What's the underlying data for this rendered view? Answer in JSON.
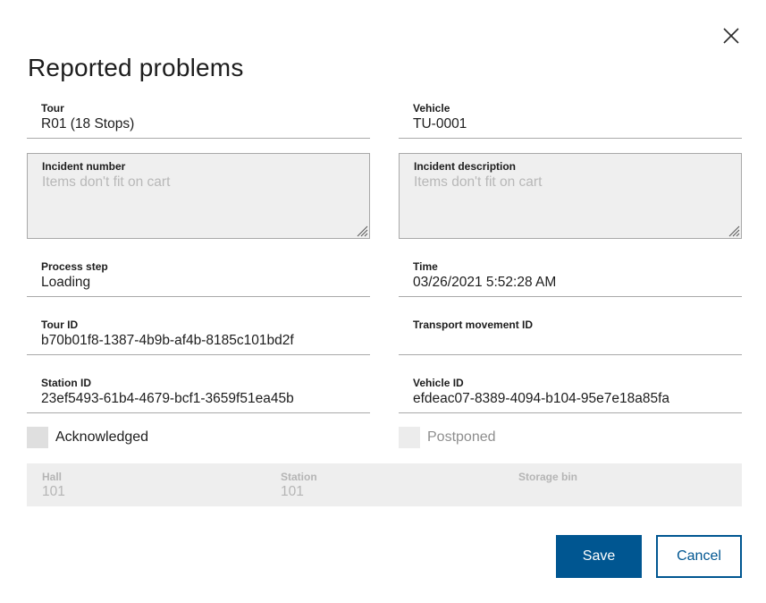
{
  "dialog": {
    "title": "Reported problems",
    "close_icon": "close-icon"
  },
  "fields": {
    "tour": {
      "label": "Tour",
      "value": "R01 (18 Stops)"
    },
    "vehicle": {
      "label": "Vehicle",
      "value": "TU-0001"
    },
    "incident_number": {
      "label": "Incident number",
      "placeholder": "Items don't fit on cart"
    },
    "incident_description": {
      "label": "Incident description",
      "placeholder": "Items don't fit on cart"
    },
    "process_step": {
      "label": "Process step",
      "value": "Loading"
    },
    "time": {
      "label": "Time",
      "value": "03/26/2021 5:52:28 AM"
    },
    "tour_id": {
      "label": "Tour ID",
      "value": "b70b01f8-1387-4b9b-af4b-8185c101bd2f"
    },
    "transport_movement_id": {
      "label": "Transport movement ID",
      "value": ""
    },
    "station_id": {
      "label": "Station ID",
      "value": "23ef5493-61b4-4679-bcf1-3659f51ea45b"
    },
    "vehicle_id": {
      "label": "Vehicle ID",
      "value": "efdeac07-8389-4094-b104-95e7e18a85fa"
    }
  },
  "checkboxes": {
    "acknowledged": {
      "label": "Acknowledged",
      "checked": false,
      "disabled": false
    },
    "postponed": {
      "label": "Postponed",
      "checked": false,
      "disabled": true
    }
  },
  "location": {
    "hall": {
      "label": "Hall",
      "value": "101"
    },
    "station": {
      "label": "Station",
      "value": "101"
    },
    "storage_bin": {
      "label": "Storage bin",
      "value": ""
    }
  },
  "actions": {
    "save_label": "Save",
    "cancel_label": "Cancel"
  },
  "colors": {
    "primary": "#005691",
    "disabled_text": "#b5b5b5",
    "field_border": "#a9a9a9"
  }
}
